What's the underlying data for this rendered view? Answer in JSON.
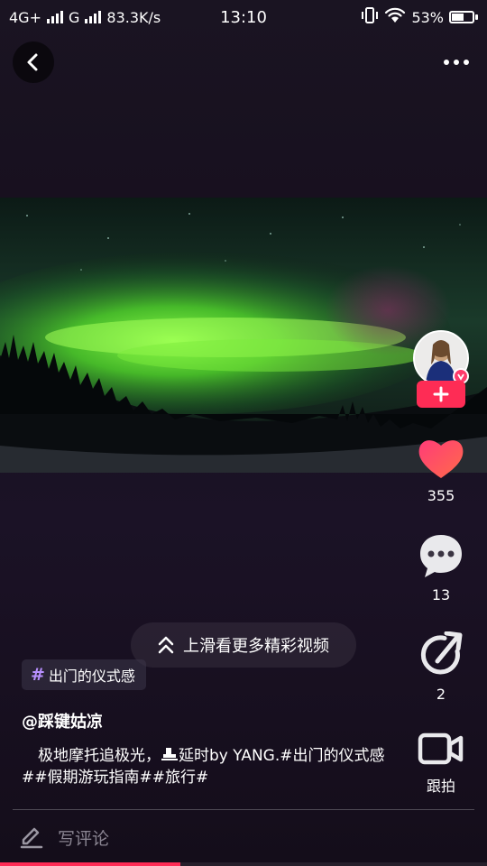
{
  "status_bar": {
    "network_left": "4G+",
    "network_right": "G",
    "speed": "83.3K/s",
    "time": "13:10",
    "battery": "53%"
  },
  "icons": {
    "back": "chevron-left-icon",
    "more": "more-dots-icon",
    "like": "heart-icon",
    "comment": "chat-bubble-icon",
    "share": "share-arrow-icon",
    "duet": "video-camera-icon",
    "edit": "pencil-icon",
    "swipe": "double-chevron-up-icon"
  },
  "creator": {
    "username": "@踩键姑凉"
  },
  "actions": {
    "likes": "355",
    "comments": "13",
    "shares": "2",
    "duet_label": "跟拍"
  },
  "swipe_hint": "上滑看更多精彩视频",
  "hashtag_chip": {
    "hash": "#",
    "text": "出门的仪式感"
  },
  "description": {
    "before_emoji": "极地摩托追极光，",
    "after_emoji": "延时by YANG.#出门的仪式感##假期游玩指南##旅行#"
  },
  "comment_input": {
    "placeholder": "写评论"
  },
  "playback": {
    "progress_fraction": 0.37
  },
  "colors": {
    "accent": "#fe2c55",
    "like": "#ff4d6d",
    "background": "#17111f"
  }
}
